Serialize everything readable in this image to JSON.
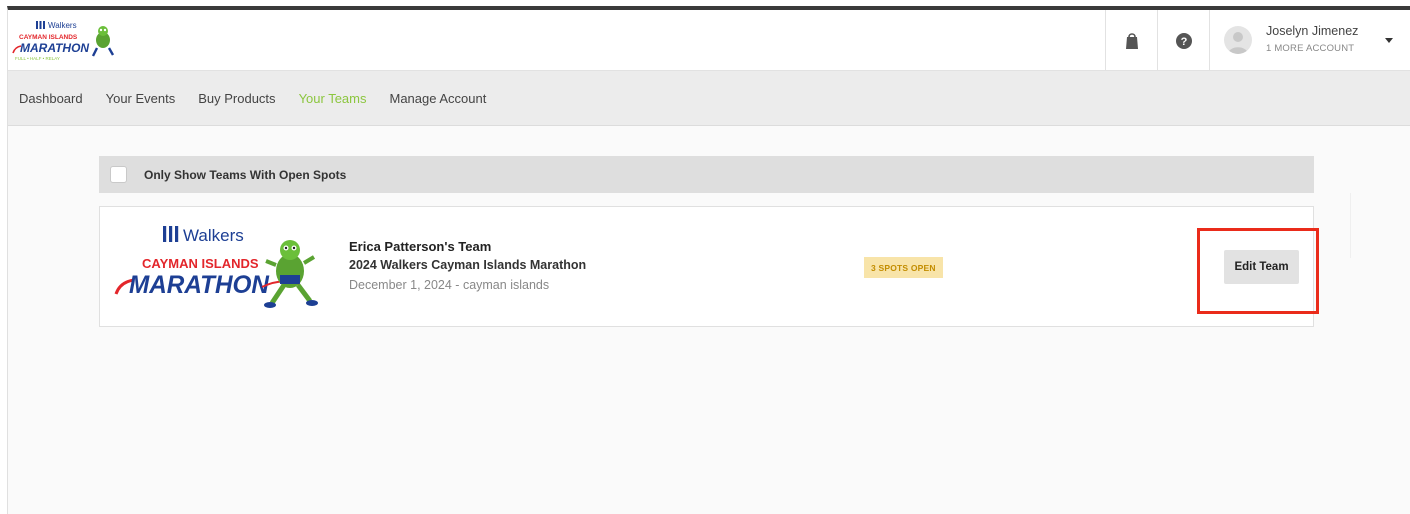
{
  "header": {
    "logo": {
      "brand": "Walkers",
      "line1": "CAYMAN ISLANDS",
      "line2": "MARATHON",
      "tagline": "FULL • HALF • RELAY"
    },
    "icons": {
      "bag": "shopping-bag-icon",
      "help": "help-icon",
      "avatar": "user-avatar-icon",
      "caret": "caret-down-icon"
    },
    "user": {
      "name": "Joselyn Jimenez",
      "accounts": "1 MORE ACCOUNT"
    }
  },
  "nav": {
    "items": [
      {
        "label": "Dashboard"
      },
      {
        "label": "Your Events"
      },
      {
        "label": "Buy Products"
      },
      {
        "label": "Your Teams",
        "active": true
      },
      {
        "label": "Manage Account"
      }
    ]
  },
  "filter": {
    "label": "Only Show Teams With Open Spots",
    "checked": false
  },
  "team": {
    "logo": {
      "brand": "Walkers",
      "line1": "CAYMAN ISLANDS",
      "line2": "MARATHON"
    },
    "name": "Erica Patterson's Team",
    "event": "2024 Walkers Cayman Islands Marathon",
    "date_location": "December 1, 2024 - cayman islands",
    "spots_badge": "3 SPOTS OPEN",
    "edit_label": "Edit Team"
  },
  "colors": {
    "accent": "#8cc63f",
    "badge_bg": "#f8e4a9",
    "badge_text": "#c38d00",
    "highlight": "#ea2b1a",
    "marathon_blue": "#1d3f94",
    "marathon_red": "#e3262b"
  }
}
